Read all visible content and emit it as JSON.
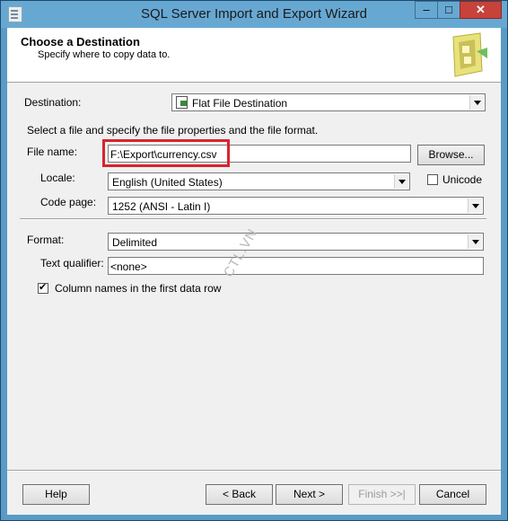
{
  "window": {
    "title": "SQL Server Import and Export Wizard",
    "minimize_symbol": "–",
    "maximize_symbol": "□",
    "close_symbol": "✕"
  },
  "header": {
    "title": "Choose a Destination",
    "subtitle": "Specify where to copy data to."
  },
  "form": {
    "destination_label": "Destination:",
    "destination_value": "Flat File Destination",
    "instructions": "Select a file and specify the file properties and the file format.",
    "file_name_label": "File name:",
    "file_name_value": "F:\\Export\\currency.csv",
    "browse_label": "Browse...",
    "locale_label": "Locale:",
    "locale_value": "English (United States)",
    "unicode_label": "Unicode",
    "unicode_checked": false,
    "code_page_label": "Code page:",
    "code_page_value": "1252  (ANSI - Latin I)",
    "format_label": "Format:",
    "format_value": "Delimited",
    "text_qualifier_label": "Text qualifier:",
    "text_qualifier_value": "<none>",
    "column_names_label": "Column names in the first data row",
    "column_names_checked": true
  },
  "footer": {
    "help": "Help",
    "back": "< Back",
    "next": "Next >",
    "finish": "Finish >>|",
    "cancel": "Cancel"
  },
  "watermark": "CTL.VN",
  "colors": {
    "title_bar": "#67a8d3",
    "close_button": "#c7423a",
    "highlight_box": "#d9232e"
  }
}
